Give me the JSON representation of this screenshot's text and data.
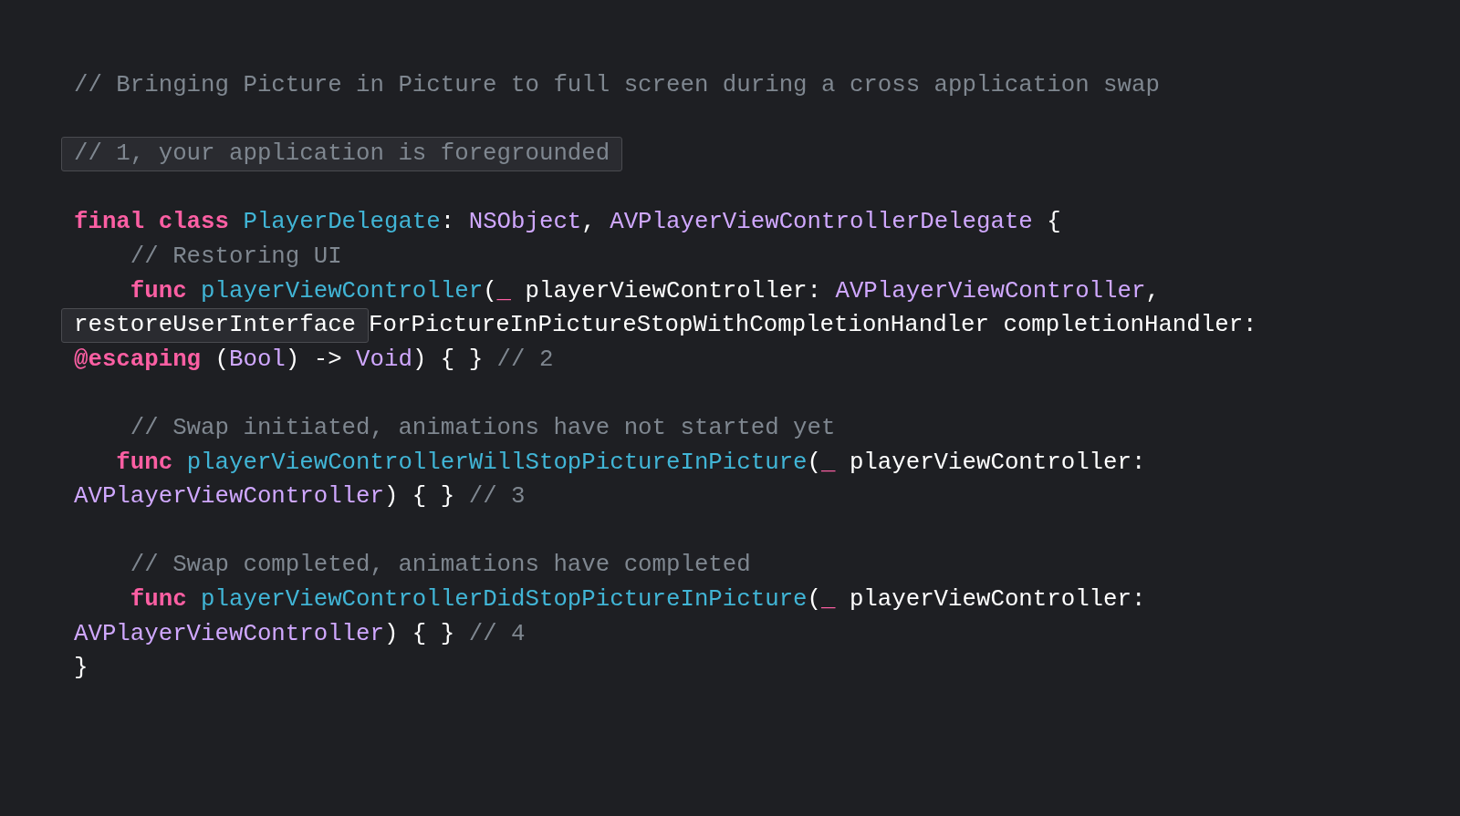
{
  "code": {
    "blocks": [
      [
        [
          {
            "kind": "comment",
            "text": "// Bringing Picture in Picture to full screen during a cross application swap",
            "highlighted": false
          }
        ]
      ],
      [
        [
          {
            "kind": "comment",
            "text": "// 1, your application is foregrounded",
            "highlighted": true
          }
        ]
      ],
      [
        [
          {
            "kind": "keyword",
            "text": "final class ",
            "highlighted": false
          },
          {
            "kind": "decl",
            "text": "PlayerDelegate",
            "highlighted": false
          },
          {
            "kind": "plain",
            "text": ": ",
            "highlighted": false
          },
          {
            "kind": "type",
            "text": "NSObject",
            "highlighted": false
          },
          {
            "kind": "plain",
            "text": ", ",
            "highlighted": false
          },
          {
            "kind": "type",
            "text": "AVPlayerViewControllerDelegate",
            "highlighted": false
          },
          {
            "kind": "plain",
            "text": " {",
            "highlighted": false
          }
        ],
        [
          {
            "kind": "comment",
            "text": "    // Restoring UI",
            "highlighted": false
          }
        ],
        [
          {
            "kind": "keyword",
            "text": "    func ",
            "highlighted": false
          },
          {
            "kind": "decl",
            "text": "playerViewController",
            "highlighted": false
          },
          {
            "kind": "plain",
            "text": "(",
            "highlighted": false
          },
          {
            "kind": "keyword",
            "text": "_",
            "highlighted": false
          },
          {
            "kind": "plain",
            "text": " playerViewController: ",
            "highlighted": false
          },
          {
            "kind": "type",
            "text": "AVPlayerViewController",
            "highlighted": false
          },
          {
            "kind": "plain",
            "text": ",",
            "highlighted": false
          }
        ],
        [
          {
            "kind": "plain",
            "text": "restoreUserInterface",
            "highlighted": true
          },
          {
            "kind": "plain",
            "text": "ForPictureInPictureStopWithCompletionHandler completionHandler:",
            "highlighted": false
          }
        ],
        [
          {
            "kind": "keyword",
            "text": "@escaping",
            "highlighted": false
          },
          {
            "kind": "plain",
            "text": " (",
            "highlighted": false
          },
          {
            "kind": "type",
            "text": "Bool",
            "highlighted": false
          },
          {
            "kind": "plain",
            "text": ") -> ",
            "highlighted": false
          },
          {
            "kind": "type",
            "text": "Void",
            "highlighted": false
          },
          {
            "kind": "plain",
            "text": ") { } ",
            "highlighted": false
          },
          {
            "kind": "comment",
            "text": "// 2",
            "highlighted": false
          }
        ]
      ],
      [
        [
          {
            "kind": "comment",
            "text": "    // Swap initiated, animations have not started yet",
            "highlighted": false
          }
        ],
        [
          {
            "kind": "keyword",
            "text": "   func ",
            "highlighted": false
          },
          {
            "kind": "decl",
            "text": "playerViewControllerWillStopPictureInPicture",
            "highlighted": false
          },
          {
            "kind": "plain",
            "text": "(",
            "highlighted": false
          },
          {
            "kind": "keyword",
            "text": "_",
            "highlighted": false
          },
          {
            "kind": "plain",
            "text": " playerViewController:",
            "highlighted": false
          }
        ],
        [
          {
            "kind": "type",
            "text": "AVPlayerViewController",
            "highlighted": false
          },
          {
            "kind": "plain",
            "text": ") { } ",
            "highlighted": false
          },
          {
            "kind": "comment",
            "text": "// 3",
            "highlighted": false
          }
        ]
      ],
      [
        [
          {
            "kind": "comment",
            "text": "    // Swap completed, animations have completed",
            "highlighted": false
          }
        ],
        [
          {
            "kind": "keyword",
            "text": "    func ",
            "highlighted": false
          },
          {
            "kind": "decl",
            "text": "playerViewControllerDidStopPictureInPicture",
            "highlighted": false
          },
          {
            "kind": "plain",
            "text": "(",
            "highlighted": false
          },
          {
            "kind": "keyword",
            "text": "_",
            "highlighted": false
          },
          {
            "kind": "plain",
            "text": " playerViewController:",
            "highlighted": false
          }
        ],
        [
          {
            "kind": "type",
            "text": "AVPlayerViewController",
            "highlighted": false
          },
          {
            "kind": "plain",
            "text": ") { } ",
            "highlighted": false
          },
          {
            "kind": "comment",
            "text": "// 4",
            "highlighted": false
          }
        ],
        [
          {
            "kind": "plain",
            "text": "}",
            "highlighted": false
          }
        ]
      ]
    ]
  }
}
